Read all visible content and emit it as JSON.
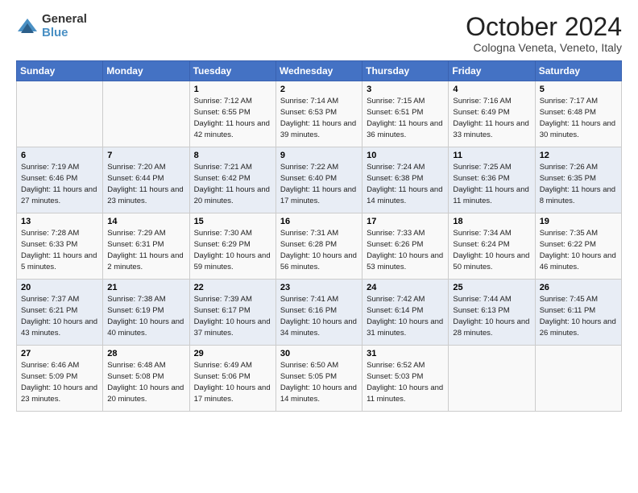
{
  "logo": {
    "general": "General",
    "blue": "Blue"
  },
  "title": "October 2024",
  "subtitle": "Cologna Veneta, Veneto, Italy",
  "days_header": [
    "Sunday",
    "Monday",
    "Tuesday",
    "Wednesday",
    "Thursday",
    "Friday",
    "Saturday"
  ],
  "weeks": [
    [
      {
        "day": "",
        "sunrise": "",
        "sunset": "",
        "daylight": ""
      },
      {
        "day": "",
        "sunrise": "",
        "sunset": "",
        "daylight": ""
      },
      {
        "day": "1",
        "sunrise": "Sunrise: 7:12 AM",
        "sunset": "Sunset: 6:55 PM",
        "daylight": "Daylight: 11 hours and 42 minutes."
      },
      {
        "day": "2",
        "sunrise": "Sunrise: 7:14 AM",
        "sunset": "Sunset: 6:53 PM",
        "daylight": "Daylight: 11 hours and 39 minutes."
      },
      {
        "day": "3",
        "sunrise": "Sunrise: 7:15 AM",
        "sunset": "Sunset: 6:51 PM",
        "daylight": "Daylight: 11 hours and 36 minutes."
      },
      {
        "day": "4",
        "sunrise": "Sunrise: 7:16 AM",
        "sunset": "Sunset: 6:49 PM",
        "daylight": "Daylight: 11 hours and 33 minutes."
      },
      {
        "day": "5",
        "sunrise": "Sunrise: 7:17 AM",
        "sunset": "Sunset: 6:48 PM",
        "daylight": "Daylight: 11 hours and 30 minutes."
      }
    ],
    [
      {
        "day": "6",
        "sunrise": "Sunrise: 7:19 AM",
        "sunset": "Sunset: 6:46 PM",
        "daylight": "Daylight: 11 hours and 27 minutes."
      },
      {
        "day": "7",
        "sunrise": "Sunrise: 7:20 AM",
        "sunset": "Sunset: 6:44 PM",
        "daylight": "Daylight: 11 hours and 23 minutes."
      },
      {
        "day": "8",
        "sunrise": "Sunrise: 7:21 AM",
        "sunset": "Sunset: 6:42 PM",
        "daylight": "Daylight: 11 hours and 20 minutes."
      },
      {
        "day": "9",
        "sunrise": "Sunrise: 7:22 AM",
        "sunset": "Sunset: 6:40 PM",
        "daylight": "Daylight: 11 hours and 17 minutes."
      },
      {
        "day": "10",
        "sunrise": "Sunrise: 7:24 AM",
        "sunset": "Sunset: 6:38 PM",
        "daylight": "Daylight: 11 hours and 14 minutes."
      },
      {
        "day": "11",
        "sunrise": "Sunrise: 7:25 AM",
        "sunset": "Sunset: 6:36 PM",
        "daylight": "Daylight: 11 hours and 11 minutes."
      },
      {
        "day": "12",
        "sunrise": "Sunrise: 7:26 AM",
        "sunset": "Sunset: 6:35 PM",
        "daylight": "Daylight: 11 hours and 8 minutes."
      }
    ],
    [
      {
        "day": "13",
        "sunrise": "Sunrise: 7:28 AM",
        "sunset": "Sunset: 6:33 PM",
        "daylight": "Daylight: 11 hours and 5 minutes."
      },
      {
        "day": "14",
        "sunrise": "Sunrise: 7:29 AM",
        "sunset": "Sunset: 6:31 PM",
        "daylight": "Daylight: 11 hours and 2 minutes."
      },
      {
        "day": "15",
        "sunrise": "Sunrise: 7:30 AM",
        "sunset": "Sunset: 6:29 PM",
        "daylight": "Daylight: 10 hours and 59 minutes."
      },
      {
        "day": "16",
        "sunrise": "Sunrise: 7:31 AM",
        "sunset": "Sunset: 6:28 PM",
        "daylight": "Daylight: 10 hours and 56 minutes."
      },
      {
        "day": "17",
        "sunrise": "Sunrise: 7:33 AM",
        "sunset": "Sunset: 6:26 PM",
        "daylight": "Daylight: 10 hours and 53 minutes."
      },
      {
        "day": "18",
        "sunrise": "Sunrise: 7:34 AM",
        "sunset": "Sunset: 6:24 PM",
        "daylight": "Daylight: 10 hours and 50 minutes."
      },
      {
        "day": "19",
        "sunrise": "Sunrise: 7:35 AM",
        "sunset": "Sunset: 6:22 PM",
        "daylight": "Daylight: 10 hours and 46 minutes."
      }
    ],
    [
      {
        "day": "20",
        "sunrise": "Sunrise: 7:37 AM",
        "sunset": "Sunset: 6:21 PM",
        "daylight": "Daylight: 10 hours and 43 minutes."
      },
      {
        "day": "21",
        "sunrise": "Sunrise: 7:38 AM",
        "sunset": "Sunset: 6:19 PM",
        "daylight": "Daylight: 10 hours and 40 minutes."
      },
      {
        "day": "22",
        "sunrise": "Sunrise: 7:39 AM",
        "sunset": "Sunset: 6:17 PM",
        "daylight": "Daylight: 10 hours and 37 minutes."
      },
      {
        "day": "23",
        "sunrise": "Sunrise: 7:41 AM",
        "sunset": "Sunset: 6:16 PM",
        "daylight": "Daylight: 10 hours and 34 minutes."
      },
      {
        "day": "24",
        "sunrise": "Sunrise: 7:42 AM",
        "sunset": "Sunset: 6:14 PM",
        "daylight": "Daylight: 10 hours and 31 minutes."
      },
      {
        "day": "25",
        "sunrise": "Sunrise: 7:44 AM",
        "sunset": "Sunset: 6:13 PM",
        "daylight": "Daylight: 10 hours and 28 minutes."
      },
      {
        "day": "26",
        "sunrise": "Sunrise: 7:45 AM",
        "sunset": "Sunset: 6:11 PM",
        "daylight": "Daylight: 10 hours and 26 minutes."
      }
    ],
    [
      {
        "day": "27",
        "sunrise": "Sunrise: 6:46 AM",
        "sunset": "Sunset: 5:09 PM",
        "daylight": "Daylight: 10 hours and 23 minutes."
      },
      {
        "day": "28",
        "sunrise": "Sunrise: 6:48 AM",
        "sunset": "Sunset: 5:08 PM",
        "daylight": "Daylight: 10 hours and 20 minutes."
      },
      {
        "day": "29",
        "sunrise": "Sunrise: 6:49 AM",
        "sunset": "Sunset: 5:06 PM",
        "daylight": "Daylight: 10 hours and 17 minutes."
      },
      {
        "day": "30",
        "sunrise": "Sunrise: 6:50 AM",
        "sunset": "Sunset: 5:05 PM",
        "daylight": "Daylight: 10 hours and 14 minutes."
      },
      {
        "day": "31",
        "sunrise": "Sunrise: 6:52 AM",
        "sunset": "Sunset: 5:03 PM",
        "daylight": "Daylight: 10 hours and 11 minutes."
      },
      {
        "day": "",
        "sunrise": "",
        "sunset": "",
        "daylight": ""
      },
      {
        "day": "",
        "sunrise": "",
        "sunset": "",
        "daylight": ""
      }
    ]
  ]
}
